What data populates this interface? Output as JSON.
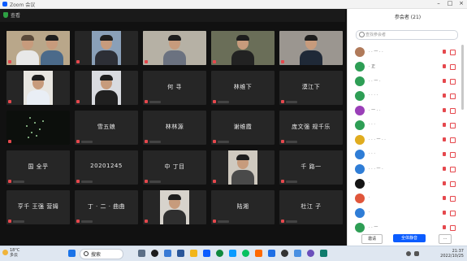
{
  "window": {
    "title": "Zoom 会议",
    "meeting_label": "查看"
  },
  "grid": {
    "tiles": [
      {
        "type": "video",
        "label": ""
      },
      {
        "type": "video",
        "label": ""
      },
      {
        "type": "video",
        "label": ""
      },
      {
        "type": "video",
        "label": ""
      },
      {
        "type": "video",
        "label": ""
      },
      {
        "type": "video",
        "label": ""
      },
      {
        "type": "video",
        "label": ""
      },
      {
        "type": "name",
        "label": "何 寻"
      },
      {
        "type": "name",
        "label": "林维下"
      },
      {
        "type": "name",
        "label": "漠江下"
      },
      {
        "type": "stars",
        "label": ""
      },
      {
        "type": "name",
        "label": "雪五娘"
      },
      {
        "type": "name",
        "label": "林林源"
      },
      {
        "type": "name",
        "label": "谢维霞"
      },
      {
        "type": "name",
        "label": "庞文强 规千乐"
      },
      {
        "type": "name",
        "label": "国 全乎"
      },
      {
        "type": "name",
        "label": "20201245"
      },
      {
        "type": "name",
        "label": "中 丁目"
      },
      {
        "type": "video",
        "label": ""
      },
      {
        "type": "name",
        "label": "千 路一"
      },
      {
        "type": "name",
        "label": "亨千 王强 营姆"
      },
      {
        "type": "name",
        "label": "丁 · 二 · 曲曲"
      },
      {
        "type": "video",
        "label": ""
      },
      {
        "type": "name",
        "label": "陆湘"
      },
      {
        "type": "name",
        "label": "杜江 子"
      }
    ]
  },
  "panel": {
    "title": "参会者 (21)",
    "search_placeholder": "查找参会者",
    "participants": [
      {
        "name": "· · 一 · ·",
        "color": "#b07a5a"
      },
      {
        "name": "· 正",
        "color": "#2e9e55"
      },
      {
        "name": "· · 一 ·",
        "color": "#2e9e55"
      },
      {
        "name": "· · · ·",
        "color": "#2e9e55"
      },
      {
        "name": "· 一 · ·",
        "color": "#9a3fb8"
      },
      {
        "name": "· · ·",
        "color": "#2e9e55"
      },
      {
        "name": "· · · 一 · ·",
        "color": "#e0ac1f"
      },
      {
        "name": "· · ·",
        "color": "#2f7dd6"
      },
      {
        "name": "· · · 一 ·",
        "color": "#2f7dd6"
      },
      {
        "name": "·",
        "color": "#151515"
      },
      {
        "name": "·",
        "color": "#e0563b"
      },
      {
        "name": "·",
        "color": "#2f7dd6"
      },
      {
        "name": "· · 一",
        "color": "#2e9e55"
      }
    ],
    "invite_label": "邀请",
    "mute_all_label": "全体静音",
    "more_label": "···"
  },
  "taskbar": {
    "weather_temp": "18°C",
    "weather_desc": "多云",
    "search_label": "搜索",
    "time": "21:37",
    "date": "2022/10/25"
  },
  "colors": {
    "zoom_blue": "#0b5cff",
    "mic_muted_red": "#e5484d",
    "speaking_yellow": "#e6d34a"
  }
}
